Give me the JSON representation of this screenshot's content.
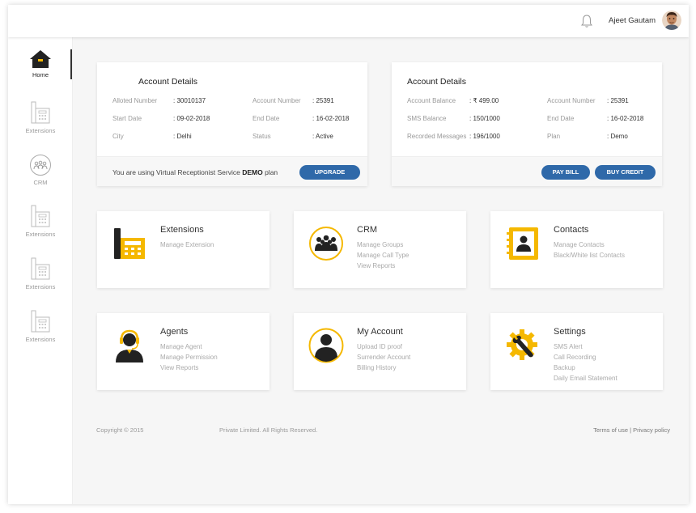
{
  "header": {
    "username": "Ajeet Gautam",
    "icons": [
      "bell-icon",
      "avatar"
    ]
  },
  "sidebar": {
    "items": [
      {
        "label": "Home",
        "icon": "home-icon",
        "active": true
      },
      {
        "label": "Extensions",
        "icon": "phone-icon"
      },
      {
        "label": "CRM",
        "icon": "group-icon"
      },
      {
        "label": "Extensions",
        "icon": "phone-icon"
      },
      {
        "label": "Extensions",
        "icon": "phone-icon"
      },
      {
        "label": "Extensions",
        "icon": "phone-icon"
      }
    ]
  },
  "account_left": {
    "title": "Account Details",
    "fields": [
      {
        "label": "Alloted Number",
        "value": ": 30010137"
      },
      {
        "label": "Account Number",
        "value": ": 25391"
      },
      {
        "label": "Start Date",
        "value": ": 09-02-2018"
      },
      {
        "label": "End Date",
        "value": ": 16-02-2018"
      },
      {
        "label": "City",
        "value": ": Delhi"
      },
      {
        "label": "Status",
        "value": ": Active"
      }
    ],
    "notice_prefix": "You are using Virtual Receptionist Service",
    "notice_bold": "DEMO",
    "notice_suffix": "plan",
    "upgrade_label": "UPGRADE"
  },
  "account_right": {
    "title": "Account Details",
    "fields": [
      {
        "label": "Account Balance",
        "value": ": ₹ 499.00"
      },
      {
        "label": "Account Number",
        "value": ": 25391"
      },
      {
        "label": "SMS Balance",
        "value": ": 150/1000"
      },
      {
        "label": "End Date",
        "value": ": 16-02-2018"
      },
      {
        "label": "Recorded Messages",
        "value": ": 196/1000"
      },
      {
        "label": "Plan",
        "value": ": Demo"
      }
    ],
    "pay_bill_label": "PAY BILL",
    "buy_credit_label": "BUY CREDIT"
  },
  "tiles": [
    {
      "title": "Extensions",
      "icon": "desk-phone-icon",
      "links": [
        "Manage Extension"
      ]
    },
    {
      "title": "CRM",
      "icon": "group-icon",
      "links": [
        "Manage Groups",
        "Manage Call Type",
        "View Reports"
      ]
    },
    {
      "title": "Contacts",
      "icon": "contact-book-icon",
      "links": [
        "Manage Contacts",
        "Black/White list Contacts"
      ]
    },
    {
      "title": "Agents",
      "icon": "headset-agent-icon",
      "links": [
        "Manage Agent",
        "Manage Permission",
        "View Reports"
      ]
    },
    {
      "title": "My Account",
      "icon": "user-icon",
      "links": [
        "Upload ID proof",
        "Surrender Account",
        "Billing History"
      ]
    },
    {
      "title": "Settings",
      "icon": "gear-wrench-icon",
      "links": [
        "SMS Alert",
        "Call Recording",
        "Backup",
        "Daily Email Statement"
      ]
    }
  ],
  "footer": {
    "copyright": "Copyright © 2015",
    "rights": "Private Limited. All Rights Reserved.",
    "terms": "Terms of use",
    "separator": "|",
    "privacy": "Privacy policy"
  },
  "colors": {
    "accent": "#2f69a9",
    "icon_yellow": "#f5b800",
    "dark": "#222222"
  }
}
